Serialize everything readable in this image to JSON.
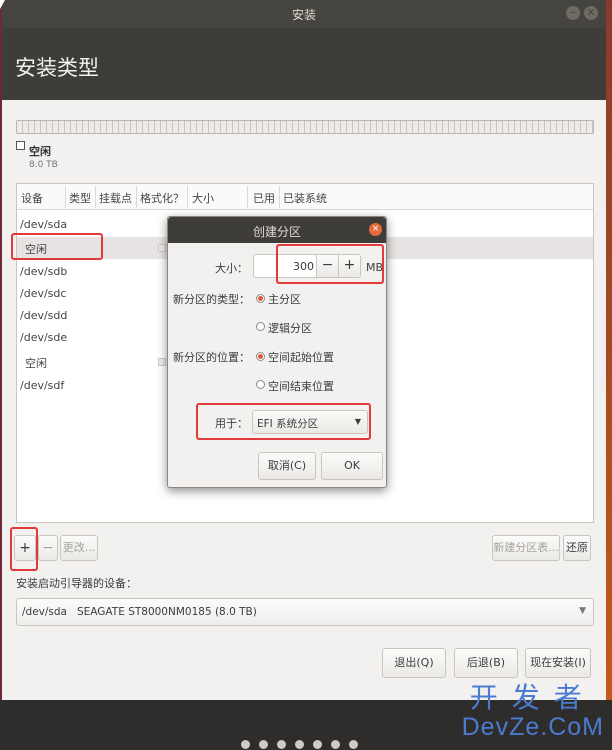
{
  "window": {
    "title": "安装"
  },
  "header": {
    "title": "安装类型"
  },
  "partition_legend": {
    "name": "空闲",
    "size": "8.0 TB"
  },
  "table": {
    "columns": [
      "设备",
      "类型",
      "挂载点",
      "格式化？",
      "大小",
      "已用",
      "已装系统"
    ],
    "rows": [
      "/dev/sda",
      "空闲",
      "/dev/sdb",
      "/dev/sdc",
      "/dev/sdd",
      "/dev/sde",
      "空闲",
      "/dev/sdf"
    ]
  },
  "toolbar": {
    "add_label": "+",
    "remove_label": "−",
    "change_label": "更改...",
    "new_table_label": "新建分区表...",
    "revert_label": "还原"
  },
  "boot": {
    "label": "安装启动引导器的设备：",
    "device": "/dev/sda",
    "model": "SEAGATE ST8000NM0185 (8.0 TB)"
  },
  "actions": {
    "quit": "退出(Q)",
    "back": "后退(B)",
    "install": "现在安装(I)"
  },
  "dialog": {
    "title": "创建分区",
    "size_label": "大小：",
    "size_value": "300",
    "size_unit": "MB",
    "minus": "−",
    "plus": "+",
    "type_label": "新分区的类型：",
    "type_primary": "主分区",
    "type_logical": "逻辑分区",
    "pos_label": "新分区的位置：",
    "pos_start": "空间起始位置",
    "pos_end": "空间结束位置",
    "use_label": "用于：",
    "use_value": "EFI 系统分区",
    "cancel": "取消(C)",
    "ok": "OK",
    "type_selected": "主分区",
    "pos_selected": "空间起始位置"
  },
  "watermark": {
    "line1": "开发者",
    "line2": "DevZe.CoM"
  },
  "icons": {
    "close": "close-icon",
    "dropdown": "chevron-down-icon"
  },
  "colors": {
    "accent": "#e2573a",
    "highlight": "#e03a3a",
    "header": "#3f3d39"
  }
}
